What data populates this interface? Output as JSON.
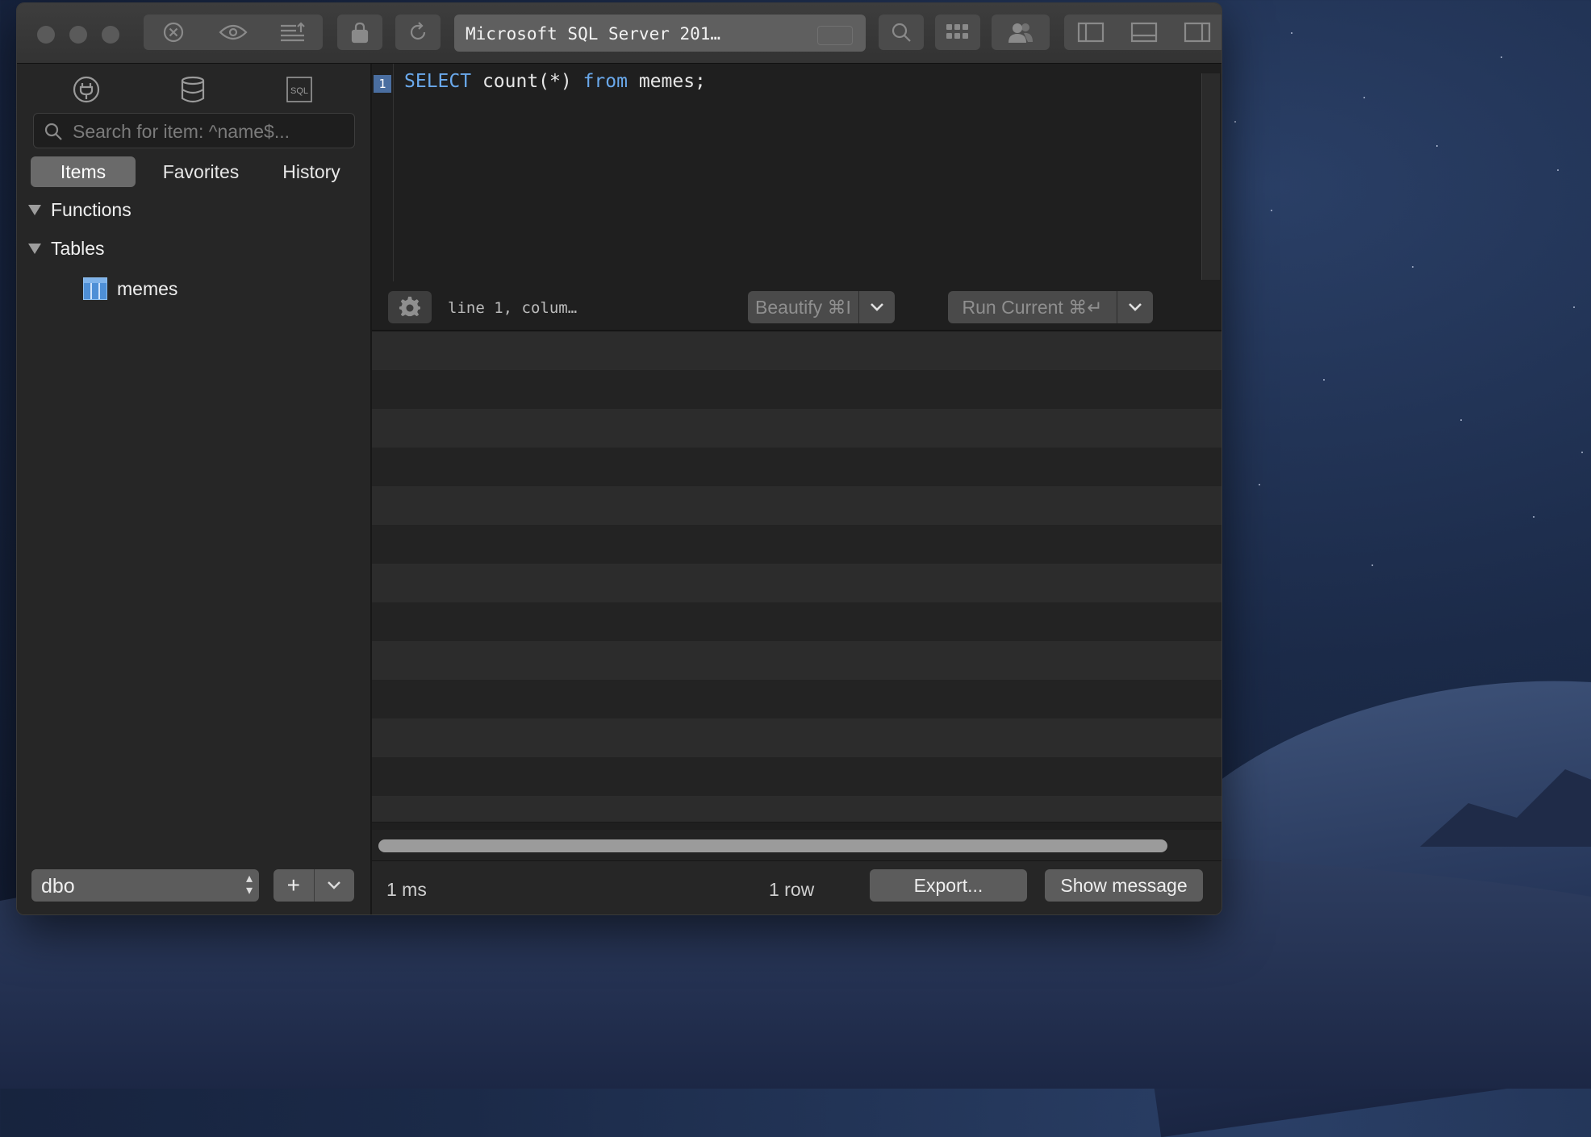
{
  "window": {
    "connection_title": "Microsoft SQL Server 201…"
  },
  "sidebar": {
    "search_placeholder": "Search for item: ^name$...",
    "tabs": [
      {
        "label": "Items",
        "active": true
      },
      {
        "label": "Favorites",
        "active": false
      },
      {
        "label": "History",
        "active": false
      }
    ],
    "tree": {
      "functions_label": "Functions",
      "tables_label": "Tables",
      "table_items": [
        "memes"
      ]
    },
    "schema_value": "dbo",
    "add_label": "+"
  },
  "editor": {
    "line_number": "1",
    "code": {
      "kw1": "SELECT",
      "mid": " count(*) ",
      "kw2": "from",
      "tail": " memes;"
    },
    "status": "line 1, colum…",
    "beautify_label": "Beautify ⌘I",
    "run_label": "Run Current ⌘↵"
  },
  "footer": {
    "duration": "1 ms",
    "row_count": "1 row",
    "export_label": "Export...",
    "show_message_label": "Show message"
  },
  "colors": {
    "keyword": "#6aa9ec",
    "active_tab": "#6a6a6a",
    "line_number_bg": "#4a6ea0"
  }
}
